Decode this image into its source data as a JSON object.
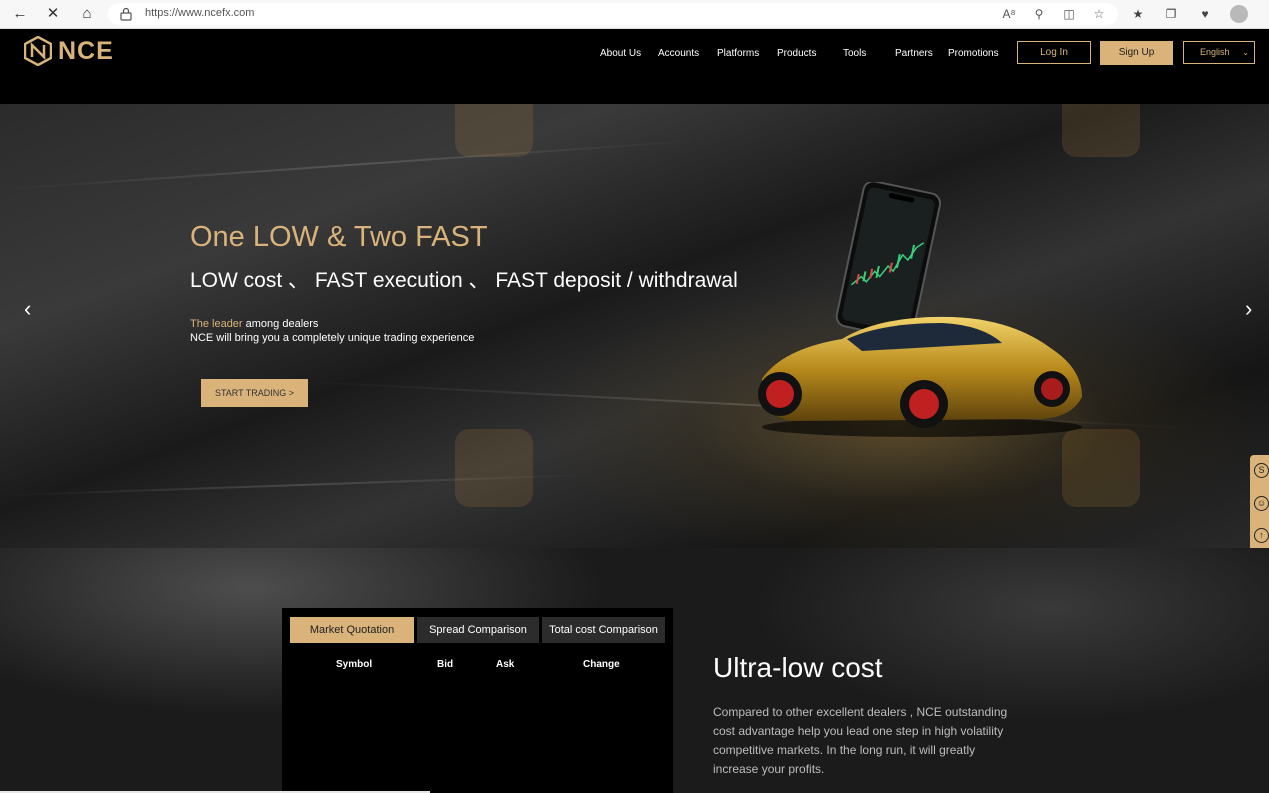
{
  "browser": {
    "url": "https://www.ncefx.com",
    "icons": [
      "back-arrow-icon",
      "stop-icon",
      "home-icon",
      "lock-icon",
      "read-aloud-icon",
      "zoom-icon",
      "split-screen-icon",
      "favorite-icon",
      "favorites-list-icon",
      "collections-icon",
      "performance-icon",
      "profile-avatar"
    ]
  },
  "header": {
    "logo_text": "NCE",
    "nav": [
      "About Us",
      "Accounts",
      "Platforms",
      "Products",
      "Tools",
      "Partners",
      "Promotions"
    ],
    "login_label": "Log In",
    "signup_label": "Sign Up",
    "language": "English"
  },
  "hero": {
    "title": "One LOW & Two FAST",
    "subtitle": "LOW cost 、 FAST execution 、 FAST deposit / withdrawal",
    "leader_highlight": "The leader",
    "leader_rest": " among dealers",
    "description": "NCE will bring you a completely unique trading experience",
    "cta_label": "START TRADING >"
  },
  "quotes": {
    "tabs": [
      {
        "label": "Market Quotation",
        "active": true
      },
      {
        "label": "Spread Comparison",
        "active": false
      },
      {
        "label": "Total cost Comparison",
        "active": false
      }
    ],
    "columns": [
      "Symbol",
      "Bid",
      "Ask",
      "Change"
    ]
  },
  "ultra": {
    "title": "Ultra-low cost",
    "text": "Compared to other excellent dealers , NCE outstanding cost advantage help you lead one step in high volatility competitive markets. In the long run, it will greatly increase your profits."
  },
  "colors": {
    "gold": "#d9b37a",
    "background": "#000000"
  }
}
